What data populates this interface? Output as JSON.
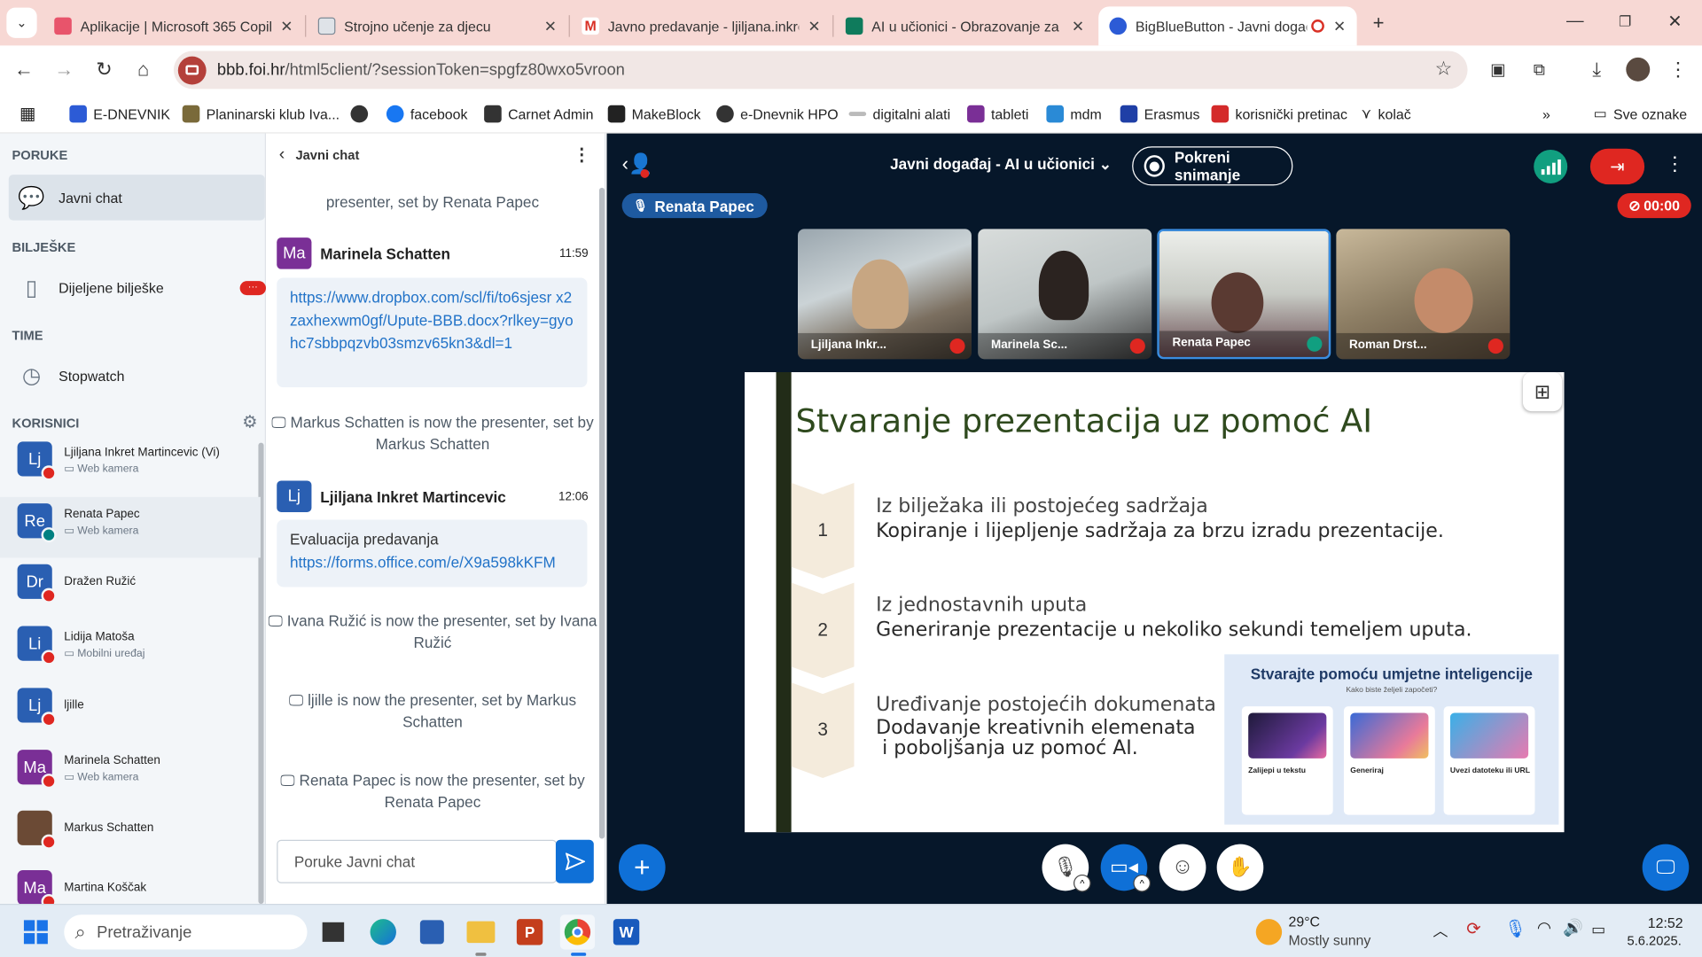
{
  "browser": {
    "tabs": [
      {
        "title": "Aplikacije | Microsoft 365 Copil",
        "color": "#e8546b"
      },
      {
        "title": "Strojno učenje za djecu",
        "color": "#7d8a96"
      },
      {
        "title": "Javno predavanje - ljiljana.inkre",
        "color": "#d93025"
      },
      {
        "title": "AI u učionici - Obrazovanje za",
        "color": "#0f7b5c"
      },
      {
        "title": "BigBlueButton - Javni događ",
        "color": "#2c5bd6"
      }
    ],
    "url_host": "bbb.foi.hr",
    "url_path": "/html5client/?sessionToken=spgfz80wxo5vroon",
    "bookmarks": [
      "E-DNEVNIK",
      "Planinarski klub Iva...",
      "",
      "facebook",
      "Carnet Admin",
      "MakeBlock",
      "e-Dnevnik HPO",
      "digitalni alati",
      "tableti",
      "mdm",
      "Erasmus",
      "korisnički pretinac",
      "kolač"
    ],
    "bookmarks_all": "Sve oznake"
  },
  "sidebar": {
    "messages_head": "PORUKE",
    "public_chat": "Javni chat",
    "notes_head": "BILJEŠKE",
    "shared_notes": "Dijeljene bilješke",
    "notes_badge": "···",
    "time_head": "TIME",
    "stopwatch": "Stopwatch",
    "users_head": "KORISNICI",
    "users": [
      {
        "initials": "Lj",
        "name": "Ljiljana Inkret Martincevic (Vi)",
        "sub": "Web kamera",
        "color": "#2a5fb2",
        "mic": "muted"
      },
      {
        "initials": "Re",
        "name": "Renata Papec",
        "sub": "Web kamera",
        "color": "#2a5fb2",
        "mic": "on"
      },
      {
        "initials": "Dr",
        "name": "Dražen Ružić",
        "sub": "",
        "color": "#2a5fb2",
        "mic": "muted"
      },
      {
        "initials": "Li",
        "name": "Lidija Matoša",
        "sub": "Mobilni uređaj",
        "color": "#2a5fb2",
        "mic": "muted"
      },
      {
        "initials": "Lj",
        "name": "ljille",
        "sub": "",
        "color": "#2a5fb2",
        "mic": "muted"
      },
      {
        "initials": "Ma",
        "name": "Marinela Schatten",
        "sub": "Web kamera",
        "color": "#7a2f96",
        "mic": "muted"
      },
      {
        "initials": "",
        "name": "Markus Schatten",
        "sub": "",
        "color": "#6b4a35",
        "mic": "muted"
      },
      {
        "initials": "Ma",
        "name": "Martina Koščak",
        "sub": "",
        "color": "#7a2f96",
        "mic": "muted"
      }
    ]
  },
  "chat": {
    "title": "Javni chat",
    "sys_top": "presenter, set by Renata Papec",
    "msg1": {
      "initials": "Ma",
      "name": "Marinela Schatten",
      "time": "11:59",
      "text": "https://www.dropbox.com/scl/fi/to6sjesr x2zaxhexwm0gf/Upute-BBB.docx?rlkey=gyohc7sbbpqzvb03smzv65kn3&dl=1"
    },
    "sys1": "Markus Schatten is now the presenter, set by Markus Schatten",
    "msg2": {
      "initials": "Lj",
      "name": "Ljiljana Inkret Martincevic",
      "time": "12:06",
      "text": "Evaluacija predavanja",
      "link": "https://forms.office.com/e/X9a598kKFM"
    },
    "sys2": "Ivana Ružić is now the presenter, set by Ivana Ružić",
    "sys3": "ljille is now the presenter, set by Markus Schatten",
    "sys4": "Renata Papec is now the presenter, set by Renata Papec",
    "placeholder": "Poruke Javni chat"
  },
  "meeting": {
    "title": "Javni događaj - AI u učionici",
    "record": "Pokreni snimanje",
    "talking": "Renata Papec",
    "timer": "00:00",
    "videos": [
      "Ljiljana Inkr...",
      "Marinela Sc...",
      "Renata Papec",
      "Roman Drst..."
    ]
  },
  "slide": {
    "title": "Stvaranje prezentacija uz pomoć  AI",
    "steps": [
      {
        "num": "1",
        "head": "Iz bilježaka ili postojećeg sadržaja",
        "body": "Kopiranje i lijepljenje sadržaja za brzu izradu prezentacije."
      },
      {
        "num": "2",
        "head": "Iz jednostavnih uputa",
        "body": "Generiranje prezentacije u nekoliko sekundi temeljem uputa."
      },
      {
        "num": "3",
        "head": "Uređivanje postojećih dokumenata",
        "body": "Dodavanje kreativnih elemenata",
        "body2": " i poboljšanja uz pomoć AI."
      }
    ],
    "panel_title": "Stvarajte pomoću umjetne inteligencije",
    "panel_sub": "Kako biste željeli započeti?",
    "cards": [
      "Zalijepi u tekstu",
      "Generiraj",
      "Uvezi datoteku ili URL"
    ]
  },
  "taskbar": {
    "search": "Pretraživanje",
    "temp": "29°C",
    "weather": "Mostly sunny",
    "time": "12:52",
    "date": "5.6.2025."
  }
}
